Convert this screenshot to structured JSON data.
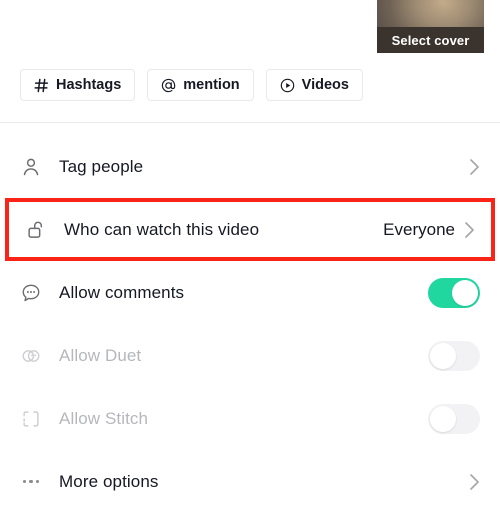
{
  "cover": {
    "label": "Select cover",
    "icon": "video-cover-thumbnail"
  },
  "chips": [
    {
      "label": "Hashtags",
      "icon": "hash-icon"
    },
    {
      "label": "mention",
      "icon": "at-icon"
    },
    {
      "label": "Videos",
      "icon": "play-circle-icon"
    }
  ],
  "settings": [
    {
      "name": "tag-people",
      "label": "Tag people",
      "icon": "person-icon",
      "control": "chevron",
      "value": "",
      "disabled": false,
      "highlighted": false
    },
    {
      "name": "who-can-watch",
      "label": "Who can watch this video",
      "icon": "unlock-icon",
      "control": "value-chevron",
      "value": "Everyone",
      "disabled": false,
      "highlighted": true
    },
    {
      "name": "allow-comments",
      "label": "Allow comments",
      "icon": "comment-bubble-icon",
      "control": "toggle-on",
      "value": "on",
      "disabled": false,
      "highlighted": false
    },
    {
      "name": "allow-duet",
      "label": "Allow Duet",
      "icon": "duet-circles-icon",
      "control": "toggle-off",
      "value": "off",
      "disabled": true,
      "highlighted": false
    },
    {
      "name": "allow-stitch",
      "label": "Allow Stitch",
      "icon": "stitch-brackets-icon",
      "control": "toggle-off",
      "value": "off",
      "disabled": true,
      "highlighted": false
    },
    {
      "name": "more-options",
      "label": "More options",
      "icon": "ellipsis-icon",
      "control": "chevron",
      "value": "",
      "disabled": false,
      "highlighted": false
    }
  ],
  "colors": {
    "accent_green": "#20d7a0",
    "highlight_red": "#fa2318",
    "text_primary": "#161823",
    "text_disabled": "#b6b7bd",
    "toggle_off": "#f2f2f4",
    "divider": "#ececee"
  }
}
